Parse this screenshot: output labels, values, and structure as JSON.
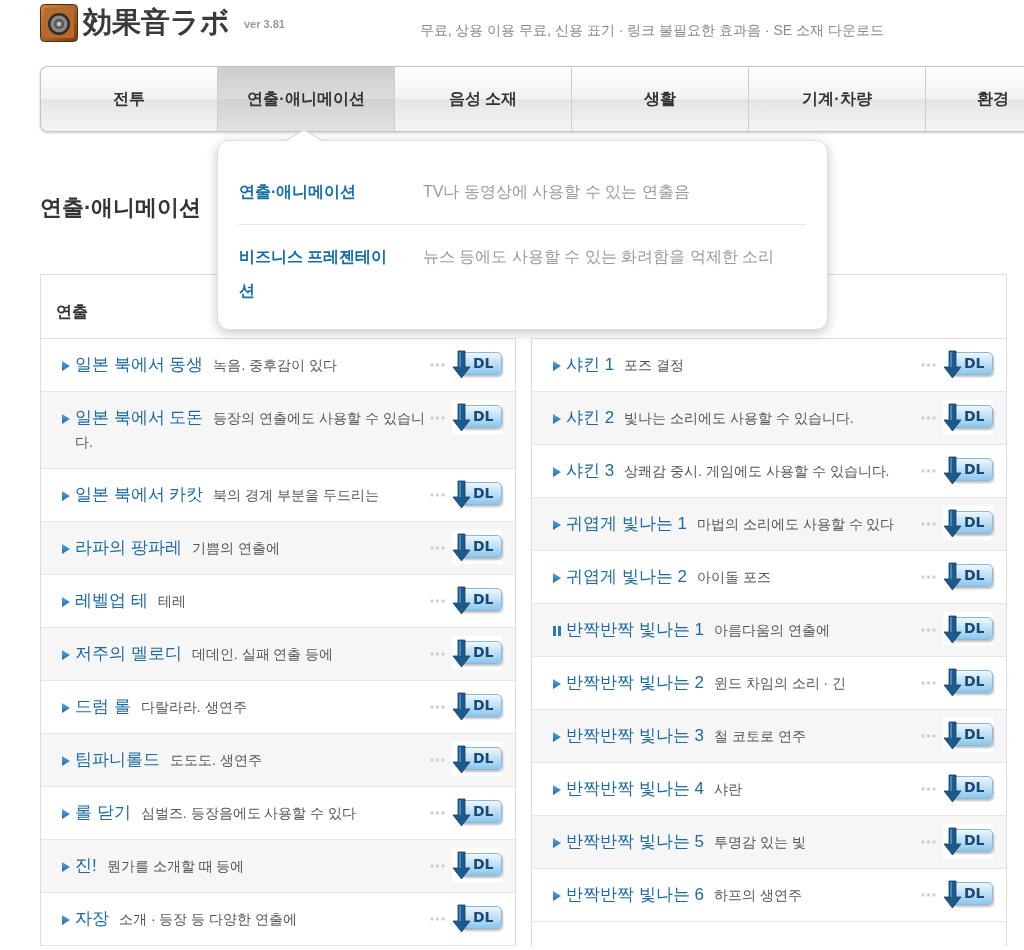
{
  "header": {
    "logo": "効果音ラボ",
    "version": "ver 3.81",
    "tagline": "무료, 상용 이용 무료, 신용 표기 · 링크 불필요한 효과음 · SE 소재 다운로드"
  },
  "nav": {
    "tabs": [
      {
        "label": "전투",
        "selected": false
      },
      {
        "label": "연출·애니메이션",
        "selected": true
      },
      {
        "label": "음성 소재",
        "selected": false
      },
      {
        "label": "생활",
        "selected": false
      },
      {
        "label": "기계·차량",
        "selected": false
      },
      {
        "label": "환경",
        "selected": false
      }
    ]
  },
  "dropdown": {
    "items": [
      {
        "label": "연출·애니메이션",
        "description": "TV나 동영상에 사용할 수 있는 연출음"
      },
      {
        "label": "비즈니스 프레젠테이션",
        "description": "뉴스 등에도 사용할 수 있는 화려함을 억제한 소리"
      }
    ]
  },
  "page_title": "연출·애니메이션",
  "section": {
    "title": "연출",
    "columns": [
      {
        "sounds": [
          {
            "title": "일본 북에서 동생",
            "description": "녹음. 중후감이 있다",
            "playing": false,
            "button": "DL"
          },
          {
            "title": "일본 북에서 도돈",
            "description": "등장의 연출에도 사용할 수 있습니다.",
            "playing": false,
            "button": "DL"
          },
          {
            "title": "일본 북에서 카캇",
            "description": "북의 경계 부분을 두드리는",
            "playing": false,
            "button": "DL"
          },
          {
            "title": "라파의 팡파레",
            "description": "기쁨의 연출에",
            "playing": false,
            "button": "DL"
          },
          {
            "title": "레벨업 테",
            "description": "테레",
            "playing": false,
            "button": "DL"
          },
          {
            "title": "저주의 멜로디",
            "description": "데데인. 실패 연출 등에",
            "playing": false,
            "button": "DL"
          },
          {
            "title": "드럼 롤",
            "description": "다랄라라. 생연주",
            "playing": false,
            "button": "DL"
          },
          {
            "title": "팀파니롤드",
            "description": "도도도. 생연주",
            "playing": false,
            "button": "DL"
          },
          {
            "title": "롤 닫기",
            "description": "심벌즈. 등장음에도 사용할 수 있다",
            "playing": false,
            "button": "DL"
          },
          {
            "title": "진!",
            "description": "뭔가를 소개할 때 등에",
            "playing": false,
            "button": "DL"
          },
          {
            "title": "자장",
            "description": "소개 · 등장 등 다양한 연출에",
            "playing": false,
            "button": "DL"
          }
        ]
      },
      {
        "sounds": [
          {
            "title": "샤킨 1",
            "description": "포즈 결정",
            "playing": false,
            "button": "DL"
          },
          {
            "title": "샤킨 2",
            "description": "빛나는 소리에도 사용할 수 있습니다.",
            "playing": false,
            "button": "DL"
          },
          {
            "title": "샤킨 3",
            "description": "상쾌감 중시. 게임에도 사용할 수 있습니다.",
            "playing": false,
            "button": "DL"
          },
          {
            "title": "귀엽게 빛나는 1",
            "description": "마법의 소리에도 사용할 수 있다",
            "playing": false,
            "button": "DL"
          },
          {
            "title": "귀엽게 빛나는 2",
            "description": "아이돌 포즈",
            "playing": false,
            "button": "DL"
          },
          {
            "title": "반짝반짝 빛나는 1",
            "description": "아름다움의 연출에",
            "playing": true,
            "button": "DL"
          },
          {
            "title": "반짝반짝 빛나는 2",
            "description": "윈드 차임의 소리 · 긴",
            "playing": false,
            "button": "DL"
          },
          {
            "title": "반짝반짝 빛나는 3",
            "description": "철 코토로 연주",
            "playing": false,
            "button": "DL"
          },
          {
            "title": "반짝반짝 빛나는 4",
            "description": "샤란",
            "playing": false,
            "button": "DL"
          },
          {
            "title": "반짝반짝 빛나는 5",
            "description": "투명감 있는 빛",
            "playing": false,
            "button": "DL"
          },
          {
            "title": "반짝반짝 빛나는 6",
            "description": "하프의 생연주",
            "playing": false,
            "button": "DL"
          }
        ]
      }
    ]
  }
}
